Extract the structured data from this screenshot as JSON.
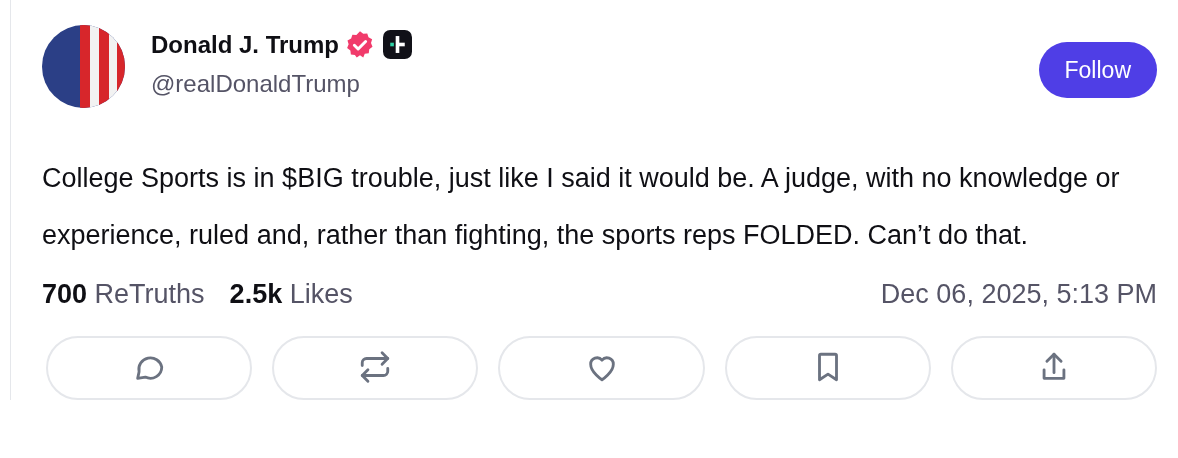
{
  "post": {
    "author": {
      "name": "Donald J. Trump",
      "handle": "@realDonaldTrump",
      "verified": true,
      "plus_badge": true
    },
    "follow_button": "Follow",
    "text": "College Sports is in $BIG trouble, just like I said it would be. A judge, with no knowledge or experience, ruled and, rather than fighting, the sports reps FOLDED. Can’t do that.",
    "stats": [
      {
        "count": "700",
        "label": "ReTruths"
      },
      {
        "count": "2.5k",
        "label": "Likes"
      }
    ],
    "timestamp": "Dec 06, 2025, 5:13 PM",
    "actions": [
      {
        "kind": "reply"
      },
      {
        "kind": "retruth"
      },
      {
        "kind": "like"
      },
      {
        "kind": "bookmark"
      },
      {
        "kind": "share"
      }
    ]
  }
}
